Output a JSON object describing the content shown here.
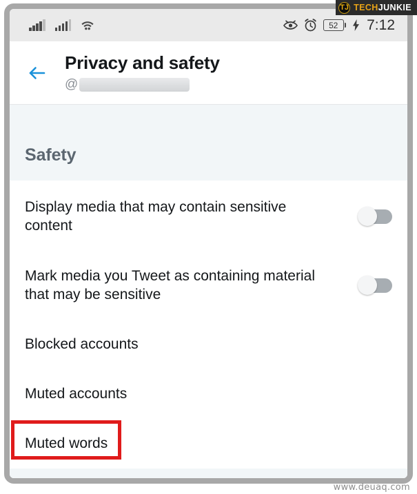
{
  "badge": {
    "logo_mark": "TJ",
    "brand_first": "TECH",
    "brand_second": "JUNKIE"
  },
  "watermark": {
    "text": "www.deuaq.com"
  },
  "status_bar": {
    "signal_icon_1": "signal-bars-icon",
    "signal_icon_2": "signal-bars-icon",
    "wifi_icon": "wifi-icon",
    "eye_icon": "eye-icon",
    "alarm_icon": "alarm-clock-icon",
    "battery_level": "52",
    "charging_icon": "charging-bolt-icon",
    "time": "7:12"
  },
  "header": {
    "back_icon": "back-arrow-icon",
    "title": "Privacy and safety",
    "handle_prefix": "@",
    "handle_redacted": true
  },
  "section": {
    "label": "Safety"
  },
  "settings": {
    "rows": [
      {
        "label": "Display media that may contain sensitive content",
        "type": "toggle",
        "value": "off"
      },
      {
        "label": "Mark media you Tweet as containing material that may be sensitive",
        "type": "toggle",
        "value": "off"
      },
      {
        "label": "Blocked accounts",
        "type": "link"
      },
      {
        "label": "Muted accounts",
        "type": "link"
      },
      {
        "label": "Muted words",
        "type": "link",
        "highlighted": true
      }
    ]
  },
  "colors": {
    "accent_blue": "#1a91da",
    "highlight_red": "#e01b1b",
    "section_bg": "#f2f6f8",
    "status_bar_bg": "#eaeaea",
    "toggle_track": "#a7adb2",
    "frame": "#a8a8a8"
  }
}
